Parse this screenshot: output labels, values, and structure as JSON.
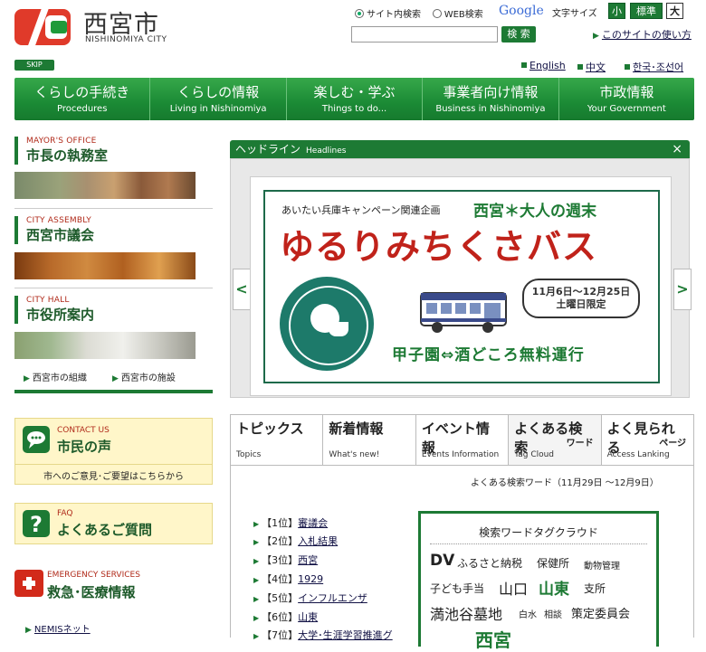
{
  "header": {
    "logo_title": "西宮市",
    "logo_sub": "NISHINOMIYA CITY",
    "search": {
      "option_site": "サイト内検索",
      "option_web": "WEB検索",
      "google": "Google",
      "button": "検 索",
      "placeholder": ""
    },
    "font_size": {
      "label": "文字サイズ",
      "small": "小",
      "standard": "標準",
      "large": "大"
    },
    "howto": "このサイトの使い方",
    "skip": "SKIP",
    "languages": [
      "English",
      "中文",
      "한국･조선어"
    ]
  },
  "nav": [
    {
      "jp": "くらしの手続き",
      "en": "Procedures"
    },
    {
      "jp": "くらしの情報",
      "en": "Living in Nishinomiya"
    },
    {
      "jp": "楽しむ・学ぶ",
      "en": "Things to do..."
    },
    {
      "jp": "事業者向け情報",
      "en": "Business in Nishinomiya"
    },
    {
      "jp": "市政情報",
      "en": "Your Government"
    }
  ],
  "sidebar": {
    "mayor": {
      "en": "MAYOR'S OFFICE",
      "jp": "市長の執務室"
    },
    "assembly": {
      "en": "CITY ASSEMBLY",
      "jp": "西宮市議会"
    },
    "hall": {
      "en": "CITY HALL",
      "jp": "市役所案内"
    },
    "hall_links": [
      "西宮市の組織",
      "西宮市の施設"
    ],
    "contact": {
      "en": "CONTACT US",
      "jp": "市民の声",
      "link": "市へのご意見･ご要望はこちらから"
    },
    "faq": {
      "en": "FAQ",
      "jp": "よくあるご質問"
    },
    "emergency": {
      "en": "EMERGENCY SERVICES",
      "jp": "救急･医療情報"
    },
    "nemis": "NEMISネット"
  },
  "headline": {
    "title": "ヘッドライン",
    "title_en": "Headlines",
    "close": "×",
    "prev": "<",
    "next": ">",
    "banner": {
      "pre": "あいたい兵庫キャンペーン関連企画",
      "pre2": "西宮＊大人の週末",
      "main": "ゆるりみちくさバス",
      "date_line1": "11月6日～12月25日",
      "date_line2": "土曜日限定",
      "free": "甲子園⇔酒どころ無料運行"
    }
  },
  "tabs": [
    {
      "jp": "トピックス",
      "en": "Topics",
      "sub": ""
    },
    {
      "jp": "新着情報",
      "en": "What's new!",
      "sub": ""
    },
    {
      "jp": "イベント情報",
      "en": "Events Information",
      "sub": ""
    },
    {
      "jp": "よくある検索",
      "en": "Tag Cloud",
      "sub": "ワード"
    },
    {
      "jp": "よく見られる",
      "en": "Access Lanking",
      "sub": "ページ"
    }
  ],
  "keywords": {
    "period": "よくある検索ワード（11月29日 ～12月9日）",
    "ranks": [
      {
        "pos": "【1位】",
        "word": "審議会"
      },
      {
        "pos": "【2位】",
        "word": "入札結果"
      },
      {
        "pos": "【3位】",
        "word": "西宮"
      },
      {
        "pos": "【4位】",
        "word": "1929"
      },
      {
        "pos": "【5位】",
        "word": "インフルエンザ"
      },
      {
        "pos": "【6位】",
        "word": "山東"
      },
      {
        "pos": "【7位】",
        "word": "大学･生涯学習推進グ"
      }
    ],
    "cloud_title": "検索ワードタグクラウド",
    "cloud_words": [
      "DV",
      "ふるさと納税",
      "保健所",
      "動物管理",
      "子ども手当",
      "山口",
      "山東",
      "支所",
      "満池谷墓地",
      "白水",
      "相談",
      "策定委員会",
      "西宮"
    ]
  }
}
